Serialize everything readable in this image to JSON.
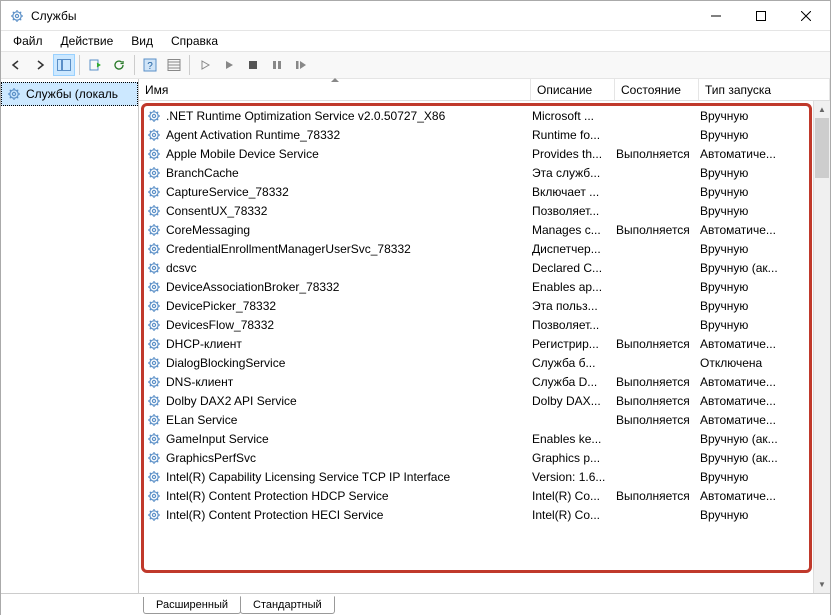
{
  "window": {
    "title": "Службы"
  },
  "menus": [
    "Файл",
    "Действие",
    "Вид",
    "Справка"
  ],
  "tree": {
    "root": "Службы (локаль"
  },
  "columns": {
    "name": "Имя",
    "desc": "Описание",
    "state": "Состояние",
    "startup": "Тип запуска"
  },
  "services": [
    {
      "name": ".NET Runtime Optimization Service v2.0.50727_X86",
      "desc": "Microsoft ...",
      "state": "",
      "startup": "Вручную"
    },
    {
      "name": "Agent Activation Runtime_78332",
      "desc": "Runtime fo...",
      "state": "",
      "startup": "Вручную"
    },
    {
      "name": "Apple Mobile Device Service",
      "desc": "Provides th...",
      "state": "Выполняется",
      "startup": "Автоматиче..."
    },
    {
      "name": "BranchCache",
      "desc": "Эта служб...",
      "state": "",
      "startup": "Вручную"
    },
    {
      "name": "CaptureService_78332",
      "desc": "Включает ...",
      "state": "",
      "startup": "Вручную"
    },
    {
      "name": "ConsentUX_78332",
      "desc": "Позволяет...",
      "state": "",
      "startup": "Вручную"
    },
    {
      "name": "CoreMessaging",
      "desc": "Manages c...",
      "state": "Выполняется",
      "startup": "Автоматиче..."
    },
    {
      "name": "CredentialEnrollmentManagerUserSvc_78332",
      "desc": "Диспетчер...",
      "state": "",
      "startup": "Вручную"
    },
    {
      "name": "dcsvc",
      "desc": "Declared C...",
      "state": "",
      "startup": "Вручную (ак..."
    },
    {
      "name": "DeviceAssociationBroker_78332",
      "desc": "Enables ap...",
      "state": "",
      "startup": "Вручную"
    },
    {
      "name": "DevicePicker_78332",
      "desc": "Эта польз...",
      "state": "",
      "startup": "Вручную"
    },
    {
      "name": "DevicesFlow_78332",
      "desc": "Позволяет...",
      "state": "",
      "startup": "Вручную"
    },
    {
      "name": "DHCP-клиент",
      "desc": "Регистрир...",
      "state": "Выполняется",
      "startup": "Автоматиче..."
    },
    {
      "name": "DialogBlockingService",
      "desc": "Служба б...",
      "state": "",
      "startup": "Отключена"
    },
    {
      "name": "DNS-клиент",
      "desc": "Служба D...",
      "state": "Выполняется",
      "startup": "Автоматиче..."
    },
    {
      "name": "Dolby DAX2 API Service",
      "desc": "Dolby DAX...",
      "state": "Выполняется",
      "startup": "Автоматиче..."
    },
    {
      "name": "ELan Service",
      "desc": "",
      "state": "Выполняется",
      "startup": "Автоматиче..."
    },
    {
      "name": "GameInput Service",
      "desc": "Enables ke...",
      "state": "",
      "startup": "Вручную (ак..."
    },
    {
      "name": "GraphicsPerfSvc",
      "desc": "Graphics p...",
      "state": "",
      "startup": "Вручную (ак..."
    },
    {
      "name": "Intel(R) Capability Licensing Service TCP IP Interface",
      "desc": "Version: 1.6...",
      "state": "",
      "startup": "Вручную"
    },
    {
      "name": "Intel(R) Content Protection HDCP Service",
      "desc": "Intel(R) Co...",
      "state": "Выполняется",
      "startup": "Автоматиче..."
    },
    {
      "name": "Intel(R) Content Protection HECI Service",
      "desc": "Intel(R) Co...",
      "state": "",
      "startup": "Вручную"
    }
  ],
  "tabs": {
    "extended": "Расширенный",
    "standard": "Стандартный"
  }
}
